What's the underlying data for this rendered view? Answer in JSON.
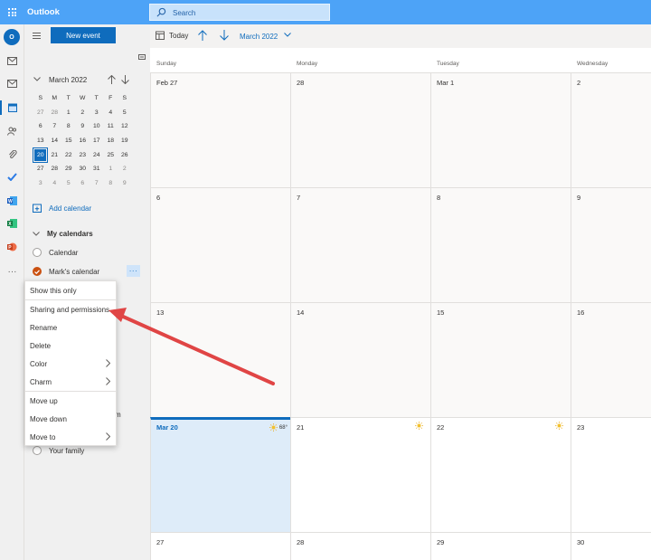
{
  "topbar": {
    "app_name": "Outlook",
    "search_placeholder": "Search"
  },
  "rail": {
    "avatar_initials": "O"
  },
  "pane": {
    "new_event_label": "New event",
    "mini_month": "March 2022",
    "weekday_letters": [
      "S",
      "M",
      "T",
      "W",
      "T",
      "F",
      "S"
    ],
    "weeks": [
      [
        "27",
        "28",
        "1",
        "2",
        "3",
        "4",
        "5"
      ],
      [
        "6",
        "7",
        "8",
        "9",
        "10",
        "11",
        "12"
      ],
      [
        "13",
        "14",
        "15",
        "16",
        "17",
        "18",
        "19"
      ],
      [
        "20",
        "21",
        "22",
        "23",
        "24",
        "25",
        "26"
      ],
      [
        "27",
        "28",
        "29",
        "30",
        "31",
        "1",
        "2"
      ],
      [
        "3",
        "4",
        "5",
        "6",
        "7",
        "8",
        "9"
      ]
    ],
    "add_calendar": "Add calendar",
    "my_calendars": "My calendars",
    "calendars": [
      "Calendar",
      "Mark's calendar"
    ],
    "more_label": "···",
    "partial_text": "m",
    "your_family": "Your family"
  },
  "context_menu": {
    "items": [
      "Show this only",
      "Sharing and permissions",
      "Rename",
      "Delete",
      "Color",
      "Charm",
      "Move up",
      "Move down",
      "Move to"
    ]
  },
  "command_bar": {
    "today_label": "Today",
    "month_label": "March 2022"
  },
  "calendar": {
    "weekdays": [
      "Sunday",
      "Monday",
      "Tuesday",
      "Wednesday"
    ],
    "weeks": [
      [
        "Feb 27",
        "28",
        "Mar 1",
        "2"
      ],
      [
        "6",
        "7",
        "8",
        "9"
      ],
      [
        "13",
        "14",
        "15",
        "16"
      ],
      [
        "Mar 20",
        "21",
        "22",
        "23"
      ],
      [
        "27",
        "28",
        "29",
        "30"
      ]
    ],
    "selected_temp": "68°"
  },
  "colors": {
    "accent": "#0f6cbd",
    "topbar": "#4da3f7",
    "calendar_dot": "#ca5010",
    "annotation_arrow": "#e04545"
  }
}
